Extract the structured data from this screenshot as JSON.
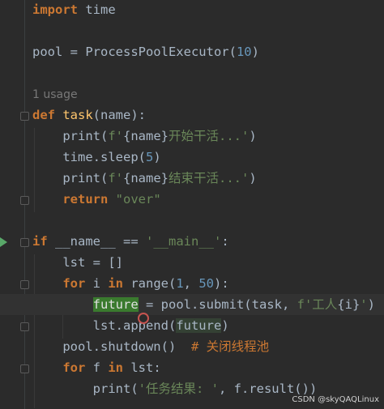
{
  "editor": {
    "lines": [
      {
        "id": "l1",
        "tokens": [
          [
            "kw",
            "import"
          ],
          [
            "plain",
            " time"
          ]
        ]
      },
      {
        "id": "l2",
        "tokens": []
      },
      {
        "id": "l3",
        "tokens": [
          [
            "plain",
            "pool = ProcessPoolExecutor("
          ],
          [
            "num",
            "10"
          ],
          [
            "plain",
            ")"
          ]
        ]
      },
      {
        "id": "l4",
        "tokens": []
      },
      {
        "id": "l5",
        "tokens": [
          [
            "hint",
            "1 usage"
          ]
        ]
      },
      {
        "id": "l6",
        "tokens": [
          [
            "kw",
            "def"
          ],
          [
            "plain",
            " "
          ],
          [
            "fn",
            "task"
          ],
          [
            "plain",
            "(name):"
          ]
        ]
      },
      {
        "id": "l7",
        "tokens": [
          [
            "plain",
            "    print("
          ],
          [
            "str",
            "f'"
          ],
          [
            "plain",
            "{name}"
          ],
          [
            "str",
            "开始干活...'"
          ],
          [
            "plain",
            ")"
          ]
        ]
      },
      {
        "id": "l8",
        "tokens": [
          [
            "plain",
            "    time.sleep("
          ],
          [
            "num",
            "5"
          ],
          [
            "plain",
            ")"
          ]
        ]
      },
      {
        "id": "l9",
        "tokens": [
          [
            "plain",
            "    print("
          ],
          [
            "str",
            "f'"
          ],
          [
            "plain",
            "{name}"
          ],
          [
            "str",
            "结束干活...'"
          ],
          [
            "plain",
            ")"
          ]
        ]
      },
      {
        "id": "l10",
        "tokens": [
          [
            "kw",
            "    return"
          ],
          [
            "plain",
            " "
          ],
          [
            "str",
            "\"over\""
          ]
        ]
      },
      {
        "id": "l11",
        "tokens": []
      },
      {
        "id": "l12",
        "tokens": [
          [
            "kw",
            "if"
          ],
          [
            "plain",
            " __name__ == "
          ],
          [
            "str",
            "'__main__'"
          ],
          [
            "plain",
            ":"
          ]
        ]
      },
      {
        "id": "l13",
        "tokens": [
          [
            "plain",
            "    lst = []"
          ]
        ]
      },
      {
        "id": "l14",
        "tokens": [
          [
            "kw",
            "    for"
          ],
          [
            "plain",
            " i "
          ],
          [
            "kw",
            "in"
          ],
          [
            "plain",
            " range("
          ],
          [
            "num",
            "1"
          ],
          [
            "plain",
            ", "
          ],
          [
            "num",
            "50"
          ],
          [
            "plain",
            "):"
          ]
        ]
      },
      {
        "id": "l15",
        "tokens": [
          [
            "plain",
            "        "
          ],
          [
            "green",
            "future"
          ],
          [
            "plain",
            " = pool.submit(task, "
          ],
          [
            "str",
            "f'工人"
          ],
          [
            "plain",
            "{i}"
          ],
          [
            "str",
            "'"
          ],
          [
            "plain",
            ")"
          ]
        ]
      },
      {
        "id": "l16",
        "tokens": [
          [
            "plain",
            "        lst.append("
          ],
          [
            "box",
            "future"
          ],
          [
            "plain",
            ")"
          ]
        ]
      },
      {
        "id": "l17",
        "tokens": [
          [
            "plain",
            "    pool.shutdown()  "
          ],
          [
            "cmt",
            "# 关闭线程池"
          ]
        ]
      },
      {
        "id": "l18",
        "tokens": [
          [
            "kw",
            "    for"
          ],
          [
            "plain",
            " f "
          ],
          [
            "kw",
            "in"
          ],
          [
            "plain",
            " lst:"
          ]
        ]
      },
      {
        "id": "l19",
        "tokens": [
          [
            "plain",
            "        print("
          ],
          [
            "str",
            "'任务结果: '"
          ],
          [
            "plain",
            ", f.result())"
          ]
        ]
      }
    ]
  },
  "watermark": "CSDN @skyQAQLinux",
  "colors": {
    "background": "#2b2b2b",
    "keyword": "#cc7832",
    "string": "#6a8759",
    "number": "#6897bb",
    "function": "#ffc66d",
    "text": "#a9b7c6"
  }
}
